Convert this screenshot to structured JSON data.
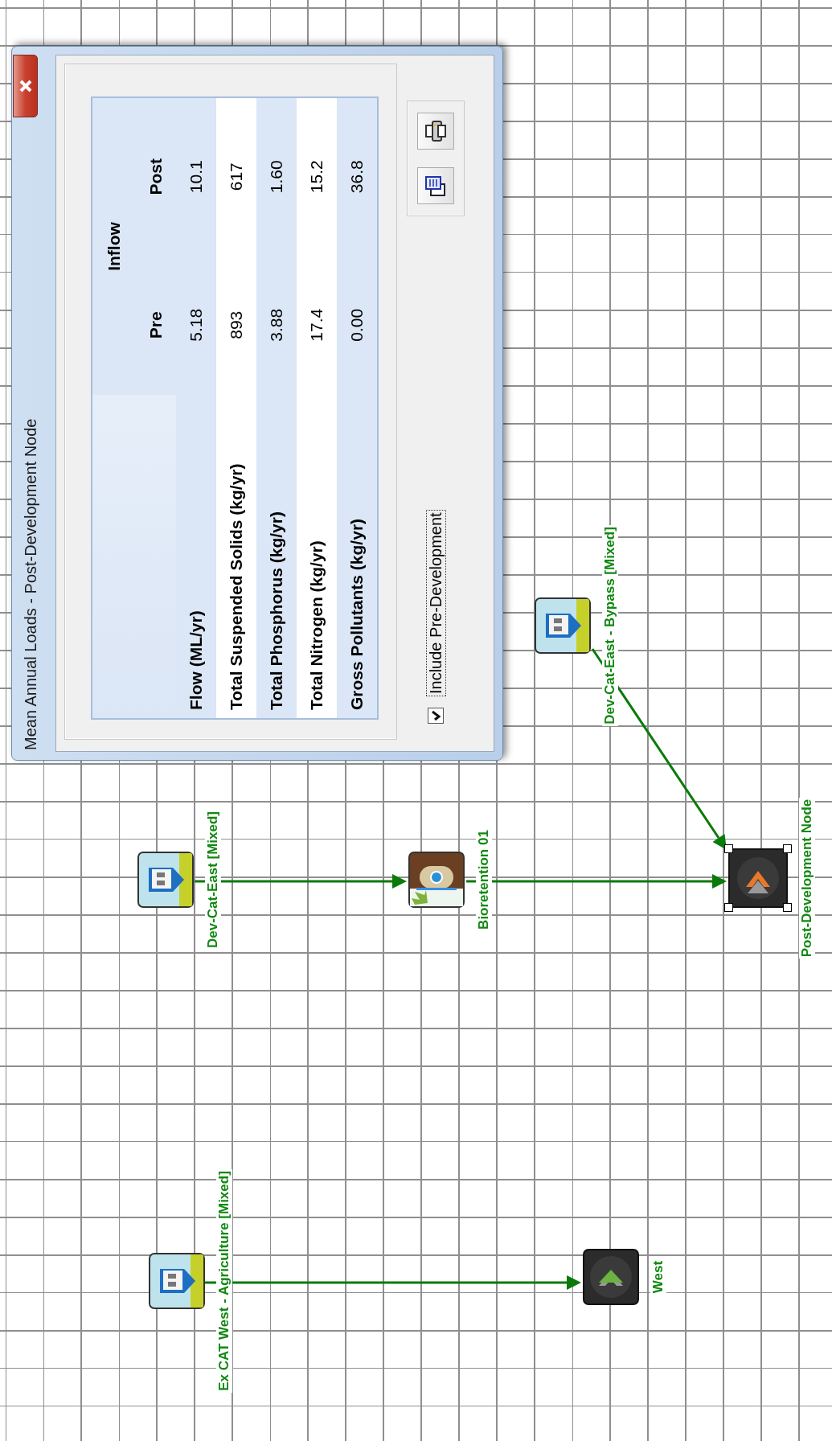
{
  "dialog": {
    "title": "Mean Annual Loads - Post-Development Node",
    "table": {
      "group_header": "Inflow",
      "columns": [
        "Pre",
        "Post"
      ],
      "rows": [
        {
          "label": "Flow (ML/yr)",
          "pre": "5.18",
          "post": "10.1"
        },
        {
          "label": "Total Suspended Solids (kg/yr)",
          "pre": "893",
          "post": "617"
        },
        {
          "label": "Total Phosphorus (kg/yr)",
          "pre": "3.88",
          "post": "1.60"
        },
        {
          "label": "Total Nitrogen (kg/yr)",
          "pre": "17.4",
          "post": "15.2"
        },
        {
          "label": "Gross Pollutants (kg/yr)",
          "pre": "0.00",
          "post": "36.8"
        }
      ]
    },
    "include_pre": {
      "label": "Include Pre-Development",
      "checked": true
    }
  },
  "nodes": [
    {
      "kind": "catchment",
      "label": "Ex CAT West - Agriculture [Mixed]",
      "selected": false
    },
    {
      "kind": "receiving",
      "label": "West",
      "selected": false
    },
    {
      "kind": "catchment",
      "label": "Dev-Cat-East [Mixed]",
      "selected": false
    },
    {
      "kind": "treatment",
      "label": "Bioretention 01",
      "selected": false
    },
    {
      "kind": "catchment",
      "label": "Dev-Cat-East - Bypass [Mixed]",
      "selected": false
    },
    {
      "kind": "post",
      "label": "Post-Development Node",
      "selected": true
    }
  ]
}
